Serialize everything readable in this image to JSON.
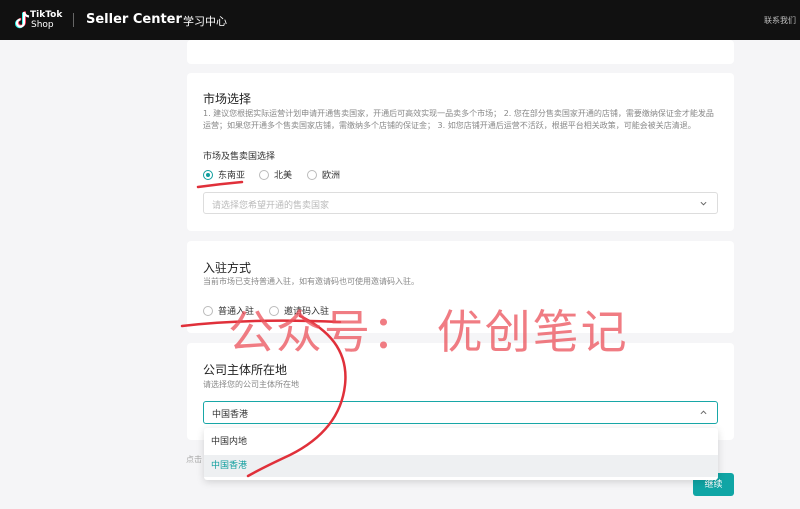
{
  "header": {
    "logo_line1": "TikTok",
    "logo_line2": "Shop",
    "brand": "Seller Center",
    "nav_learning": "学习中心",
    "contact": "联系我们"
  },
  "market": {
    "title": "市场选择",
    "description": "1. 建议您根据实际运营计划申请开通售卖国家，开通后可高效实现一品卖多个市场； 2. 您在部分售卖国家开通的店铺，需要缴纳保证金才能发品运营；如果您开通多个售卖国家店铺，需缴纳多个店铺的保证金； 3. 如您店铺开通后运营不活跃，根据平台相关政策，可能会被关店清退。",
    "field_label": "市场及售卖国选择",
    "options": [
      "东南亚",
      "北美",
      "欧洲"
    ],
    "selected": "东南亚",
    "country_placeholder": "请选择您希望开通的售卖国家"
  },
  "entry": {
    "title": "入驻方式",
    "description": "当前市场已支持普通入驻，如有邀请码也可使用邀请码入驻。",
    "options": [
      "普通入驻",
      "邀请码入驻"
    ]
  },
  "company": {
    "title": "公司主体所在地",
    "description": "请选择您的公司主体所在地",
    "selected_value": "中国香港",
    "dropdown_options": [
      "中国内地",
      "中国香港"
    ]
  },
  "footer": {
    "hint": "点击",
    "next_label": "继续"
  },
  "watermark": "公众号： 优创笔记",
  "colors": {
    "accent": "#10a5a5",
    "topbar": "#111111",
    "annotation": "#e0303a"
  }
}
